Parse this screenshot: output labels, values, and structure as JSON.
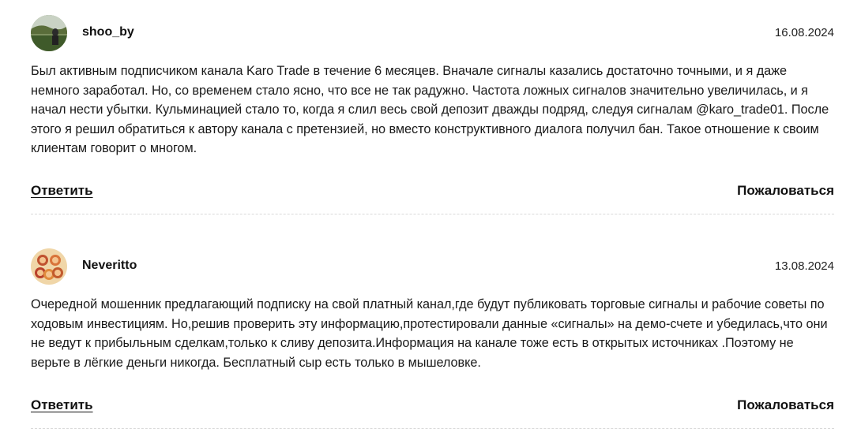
{
  "comments": [
    {
      "author": "shoo_by",
      "date": "16.08.2024",
      "text": "Был активным подписчиком канала Karo Trade в течение 6 месяцев. Вначале сигналы казались достаточно точными, и я даже немного заработал. Но, со временем стало ясно, что все не так радужно. Частота ложных сигналов значительно увеличилась, и я начал нести убытки. Кульминацией стало то, когда я слил весь свой депозит дважды подряд, следуя сигналам @karo_trade01. После этого я решил обратиться к автору канала с претензией, но вместо конструктивного диалога получил бан. Такое отношение к своим клиентам говорит о многом.",
      "reply_label": "Ответить",
      "complain_label": "Пожаловаться"
    },
    {
      "author": "Neveritto",
      "date": "13.08.2024",
      "text": "Очередной мошенник предлагающий подписку на свой платный канал,где будут публиковать торговые сигналы и рабочие советы по ходовым инвестициям. Но,решив проверить эту информацию,протестировали данные «сигналы» на демо-счете и убедилась,что они не ведут к прибыльным сделкам,только к сливу депозита.Информация на канале тоже есть в открытых источниках .Поэтому не верьте в лёгкие деньги никогда. Бесплатный сыр есть только в мышеловке.",
      "reply_label": "Ответить",
      "complain_label": "Пожаловаться"
    }
  ]
}
